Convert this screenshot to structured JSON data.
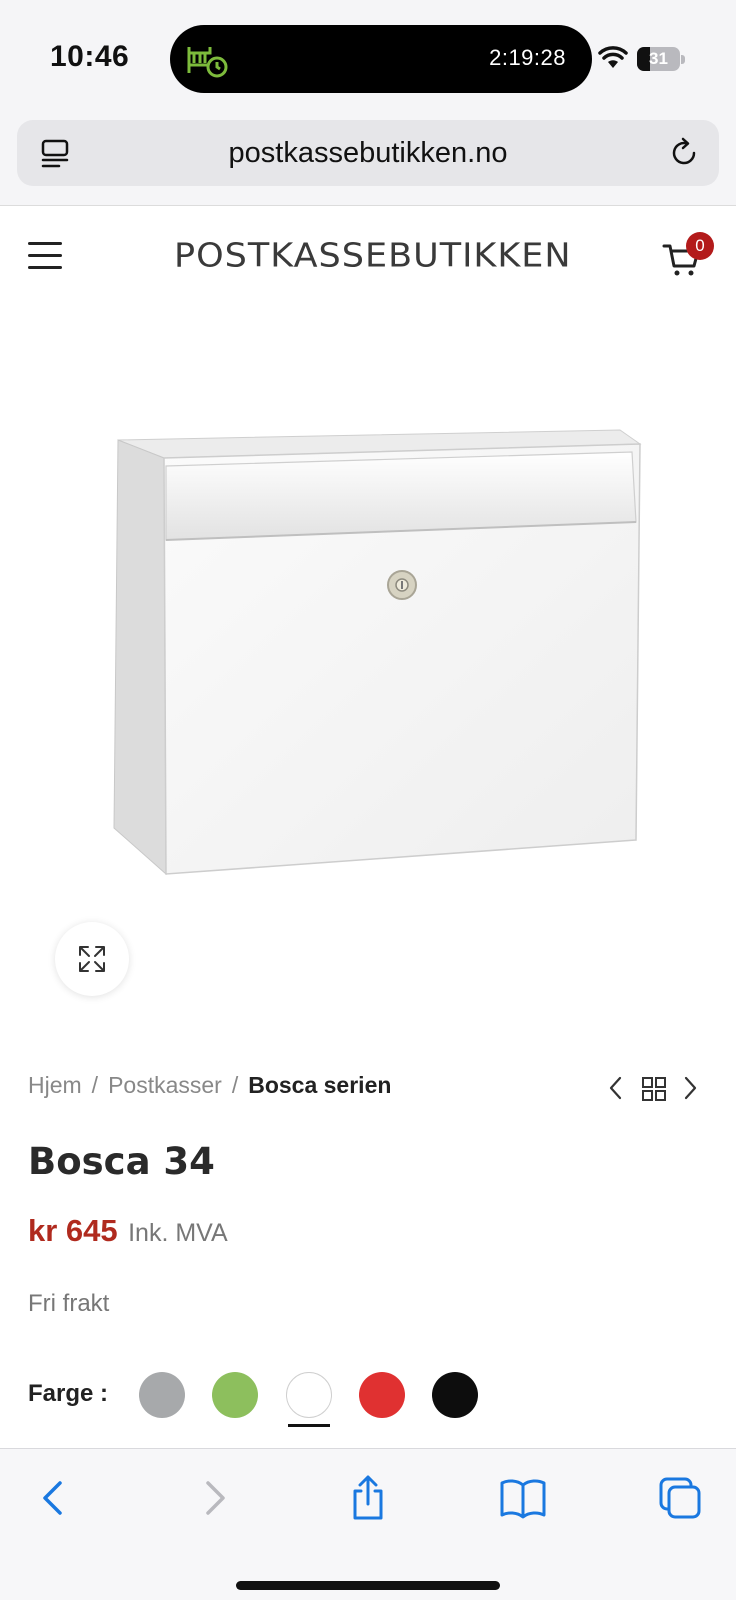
{
  "status_bar": {
    "time": "10:46",
    "timer": "2:19:28",
    "battery_text": "31",
    "battery_level": 0.31,
    "island_icon": "alarm-bed-icon",
    "accent_color": "#7dbb3c"
  },
  "browser": {
    "url": "postkassebutikken.no",
    "reader_icon": "reader-icon",
    "reload_icon": "reload-icon"
  },
  "site": {
    "logo": "POSTKASSEBUTIKKEN",
    "cart_count": "0",
    "badge_color": "#b31b1b"
  },
  "breadcrumb": {
    "items": [
      "Hjem",
      "Postkasser"
    ],
    "separator": "/",
    "current": "Bosca serien"
  },
  "product": {
    "title": "Bosca 34",
    "price": "kr 645",
    "vat_note": "Ink. MVA",
    "shipping": "Fri frakt",
    "price_color": "#b02a1e",
    "color_label": "Farge :",
    "colors": [
      {
        "name": "grey",
        "hex": "#a7a9ab"
      },
      {
        "name": "green",
        "hex": "#8dbf5d"
      },
      {
        "name": "white",
        "hex": "#ffffff",
        "selected": true
      },
      {
        "name": "red",
        "hex": "#e03131"
      },
      {
        "name": "black",
        "hex": "#0d0d0d"
      }
    ]
  },
  "toolbar": {
    "accent_color": "#1a78e0",
    "items": [
      "back-icon",
      "forward-icon",
      "share-icon",
      "bookmarks-icon",
      "tabs-icon"
    ]
  }
}
